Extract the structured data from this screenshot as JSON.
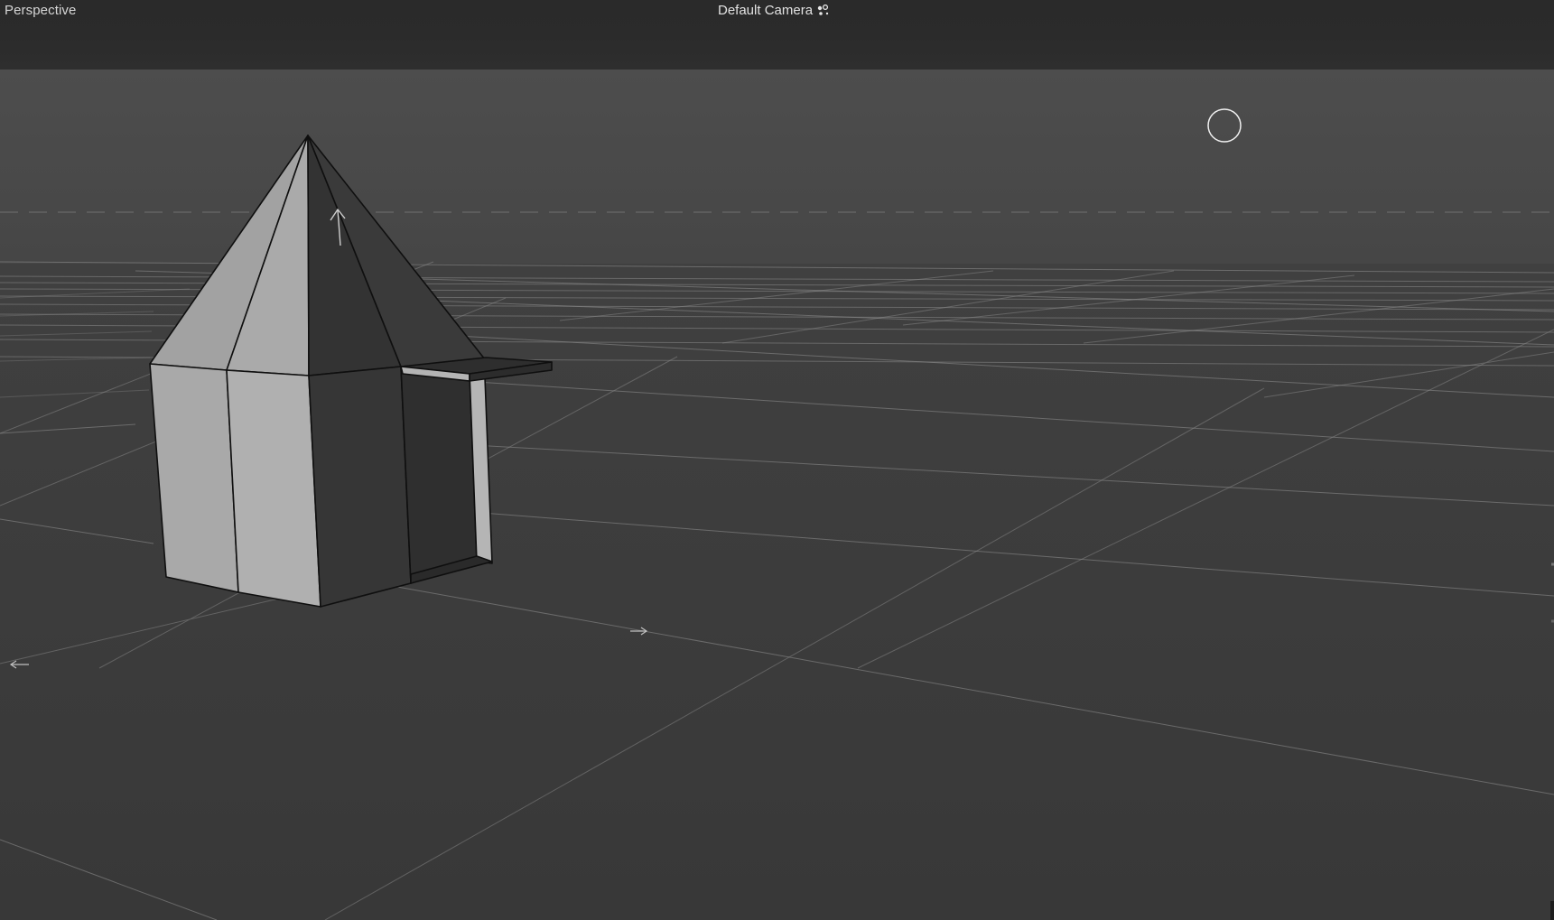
{
  "viewport": {
    "view_mode": "Perspective",
    "camera": "Default Camera"
  },
  "icons": {
    "camera_options": "camera-options-icon",
    "light_gizmo": "light-gizmo-icon",
    "up_axis": "up-arrow-icon"
  },
  "colors": {
    "topbar": "#2b2b2b",
    "sky": "#4b4b4b",
    "ground": "#3a3a3a",
    "grid": "#8a8a8a",
    "light_face": "#a6a6a6",
    "dark_face": "#373737",
    "edges": "#111111"
  }
}
